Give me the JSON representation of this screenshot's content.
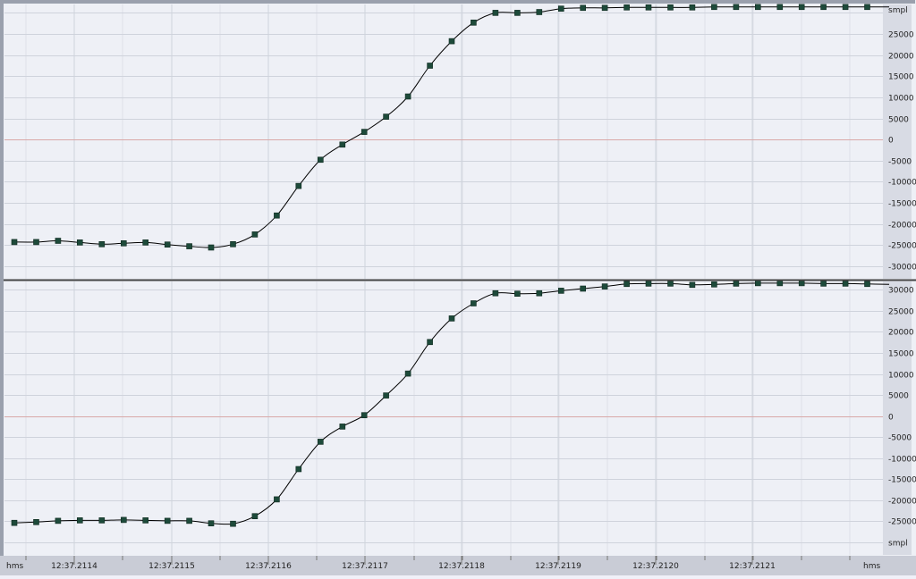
{
  "colors": {
    "background": "#eef0f6",
    "grid": "#cfd3dc",
    "zero_line": "#d9a8a8",
    "curve": "#000000",
    "marker": "#1d4a3a"
  },
  "icons": {
    "marker": "square-marker"
  },
  "chart_data": [
    {
      "type": "line",
      "panel": "top",
      "ylabel": "smpl",
      "ylim": [
        -33000,
        32000
      ],
      "yticks": [
        30000,
        25000,
        20000,
        15000,
        10000,
        5000,
        0,
        -5000,
        -10000,
        -15000,
        -20000,
        -25000,
        -30000
      ],
      "ytick_labels": [
        "",
        "25000",
        "20000",
        "15000",
        "10000",
        "5000",
        "0",
        "-5000",
        "-10000",
        "-15000",
        "-20000",
        "-25000",
        "-30000"
      ],
      "zero_line": true,
      "grid": true,
      "series": [
        {
          "sample_index": [
            0,
            1,
            2,
            3,
            4,
            5,
            6,
            7,
            8,
            9,
            10,
            11,
            12,
            13,
            14,
            15,
            16,
            17,
            18,
            19,
            20,
            21,
            22,
            23,
            24,
            25,
            26,
            27,
            28,
            29,
            30,
            31,
            32,
            33,
            34,
            35,
            36,
            37,
            38,
            39,
            40
          ],
          "values": [
            -24300,
            -24300,
            -24000,
            -24400,
            -24800,
            -24600,
            -24400,
            -24900,
            -25300,
            -25600,
            -24800,
            -22500,
            -18000,
            -11000,
            -4800,
            -1200,
            1800,
            5400,
            10200,
            17500,
            23300,
            27700,
            30000,
            30000,
            30200,
            31000,
            31200,
            31200,
            31300,
            31300,
            31300,
            31300,
            31400,
            31400,
            31400,
            31400,
            31400,
            31400,
            31400,
            31400,
            31400
          ]
        }
      ]
    },
    {
      "type": "line",
      "panel": "bottom",
      "ylabel": "smpl",
      "ylim": [
        -33000,
        32000
      ],
      "yticks": [
        30000,
        25000,
        20000,
        15000,
        10000,
        5000,
        0,
        -5000,
        -10000,
        -15000,
        -20000,
        -25000,
        -30000
      ],
      "ytick_labels": [
        "30000",
        "25000",
        "20000",
        "15000",
        "10000",
        "5000",
        "0",
        "-5000",
        "-10000",
        "-15000",
        "-20000",
        "-25000",
        "smpl"
      ],
      "zero_line": true,
      "grid": true,
      "series": [
        {
          "sample_index": [
            0,
            1,
            2,
            3,
            4,
            5,
            6,
            7,
            8,
            9,
            10,
            11,
            12,
            13,
            14,
            15,
            16,
            17,
            18,
            19,
            20,
            21,
            22,
            23,
            24,
            25,
            26,
            27,
            28,
            29,
            30,
            31,
            32,
            33,
            34,
            35,
            36,
            37,
            38,
            39,
            40
          ],
          "values": [
            -25400,
            -25200,
            -24900,
            -24800,
            -24800,
            -24700,
            -24800,
            -24900,
            -24900,
            -25500,
            -25600,
            -23800,
            -19800,
            -12600,
            -6100,
            -2500,
            200,
            4900,
            10100,
            17600,
            23200,
            26800,
            29200,
            29100,
            29200,
            29800,
            30300,
            30800,
            31400,
            31500,
            31500,
            31200,
            31300,
            31500,
            31600,
            31600,
            31600,
            31500,
            31500,
            31400,
            31300
          ]
        }
      ]
    }
  ],
  "x_axis": {
    "unit_left": "hms",
    "unit_right": "hms",
    "tick_labels": [
      "12:37.2114",
      "12:37.2115",
      "12:37.2116",
      "12:37.2117",
      "12:37.2118",
      "12:37.2119",
      "12:37.2120",
      "12:37.2121"
    ]
  }
}
